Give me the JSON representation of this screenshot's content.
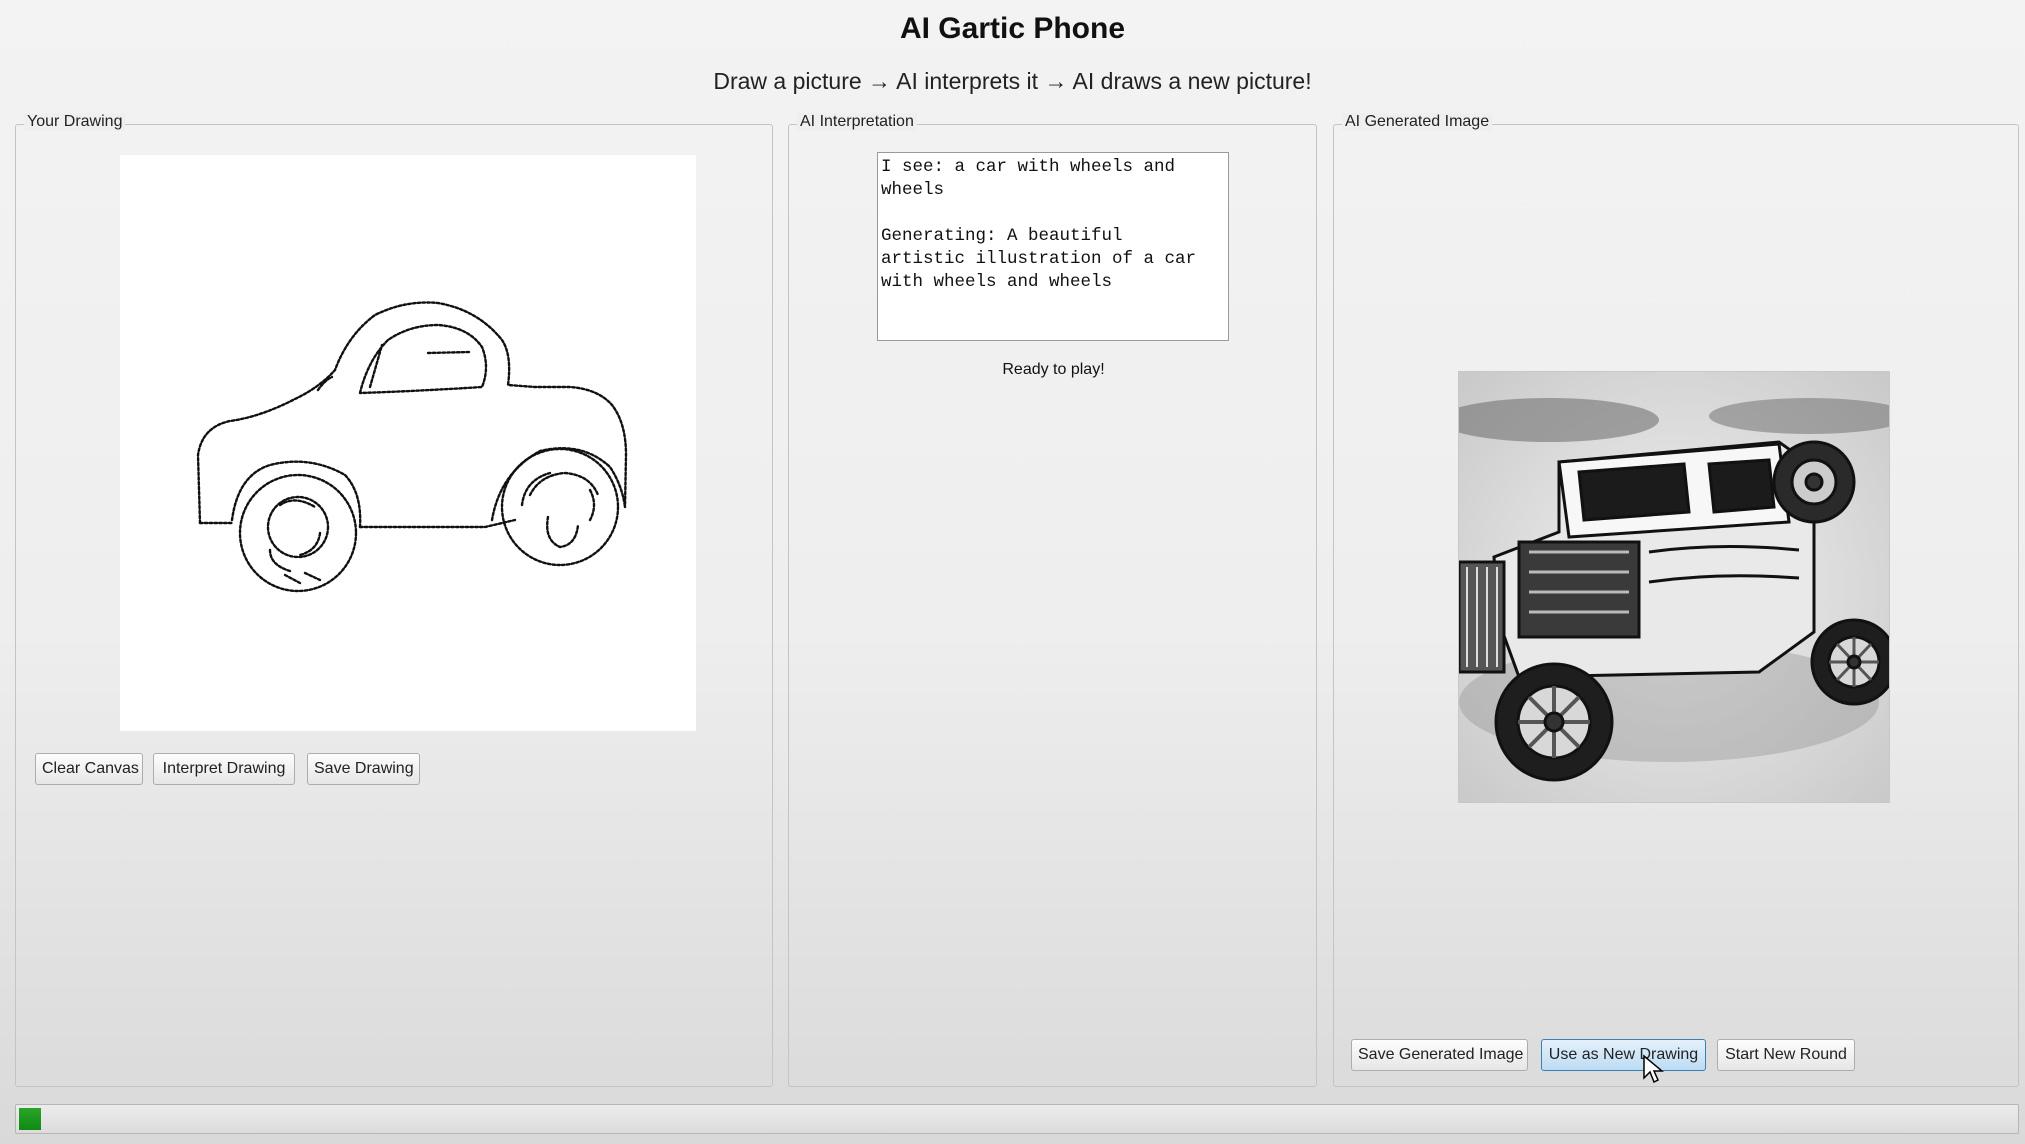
{
  "header": {
    "title": "AI Gartic Phone",
    "subtitle": "Draw a picture → AI interprets it → AI draws a new picture!"
  },
  "drawing_panel": {
    "label": "Your Drawing",
    "buttons": {
      "clear": "Clear Canvas",
      "interpret": "Interpret Drawing",
      "save": "Save Drawing"
    }
  },
  "interpretation_panel": {
    "label": "AI Interpretation",
    "text": "I see: a car with wheels and\nwheels\n\nGenerating: A beautiful\nartistic illustration of a car\nwith wheels and wheels",
    "status": "Ready to play!"
  },
  "generated_panel": {
    "label": "AI Generated Image",
    "buttons": {
      "save": "Save Generated Image",
      "use_as_new": "Use as New Drawing",
      "new_round": "Start New Round"
    }
  },
  "progress": {
    "fraction": 0.011,
    "color": "#1a961d"
  },
  "icons": {
    "cursor": "mouse-pointer-icon"
  }
}
